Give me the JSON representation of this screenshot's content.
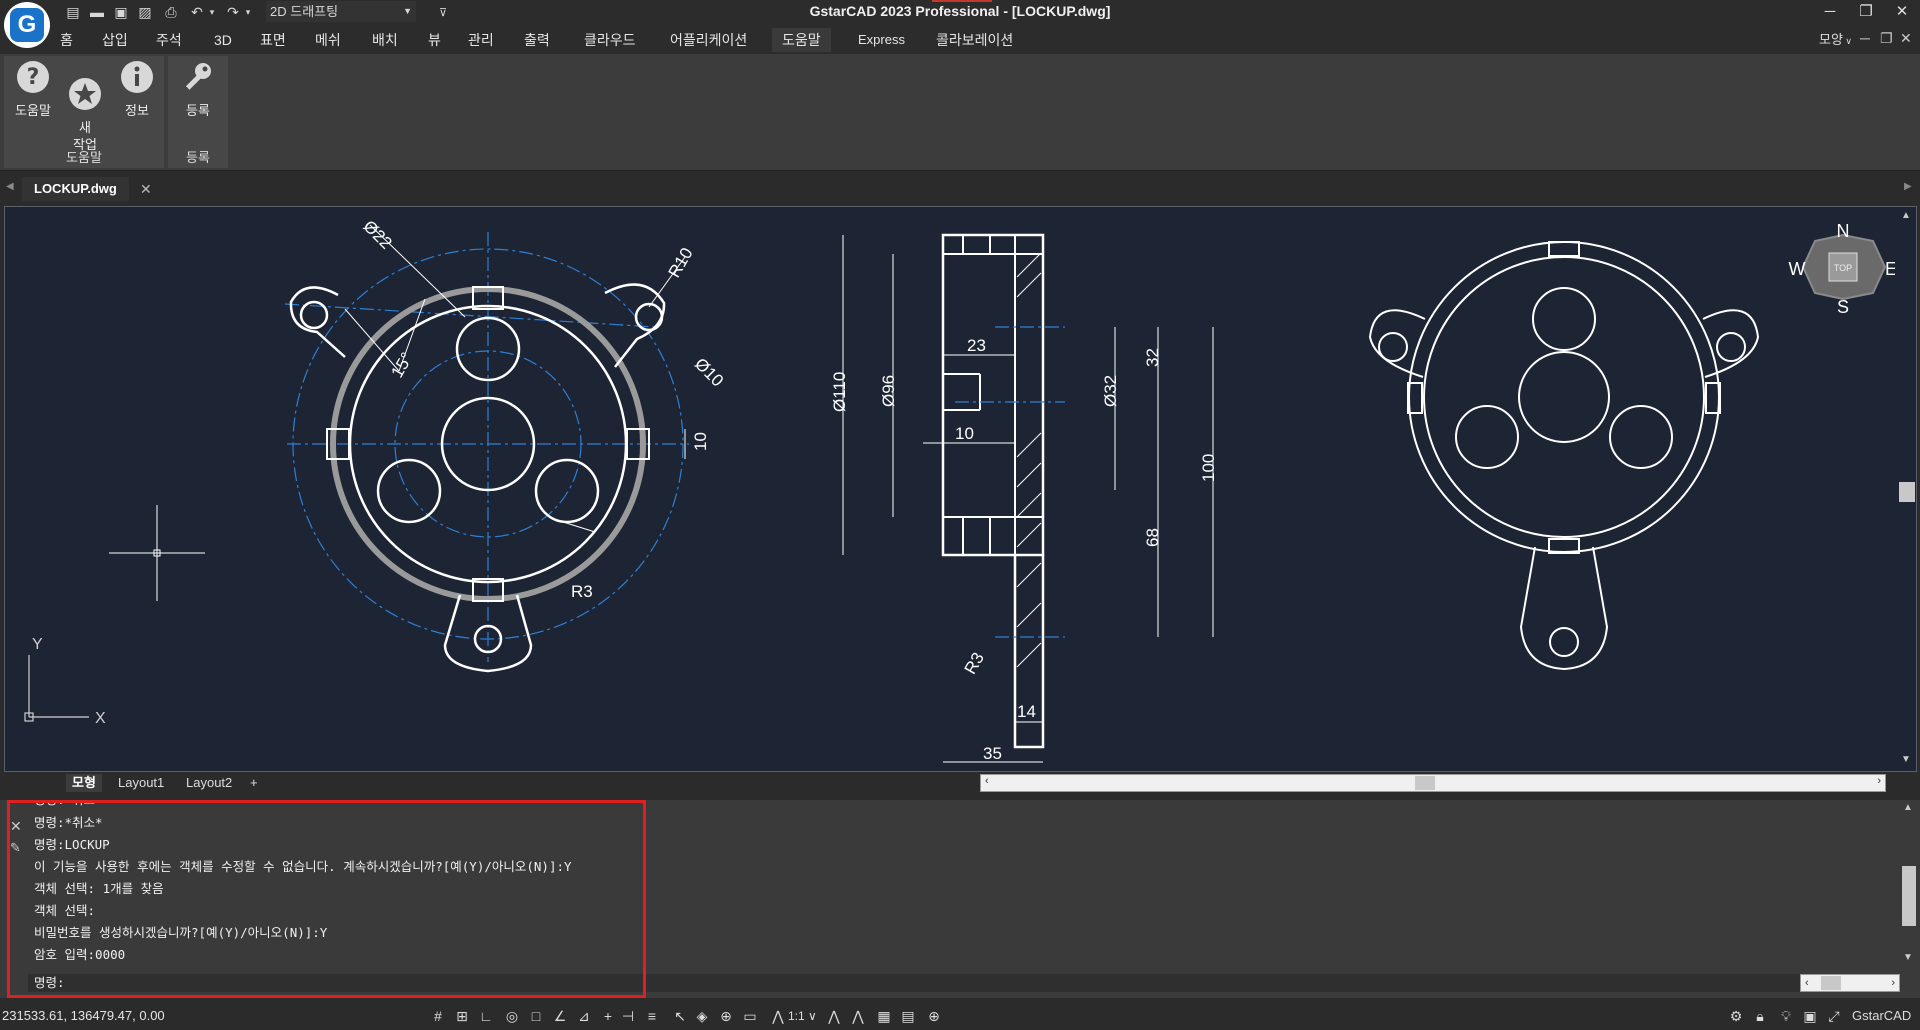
{
  "window": {
    "title": "GstarCAD 2023 Professional - [LOCKUP.dwg]",
    "workspace": "2D 드래프팅",
    "minimize": "─",
    "restore": "❐",
    "close": "✕"
  },
  "ribbon_tabs": [
    "홈",
    "삽입",
    "주석",
    "3D",
    "표면",
    "메쉬",
    "배치",
    "뷰",
    "관리",
    "출력",
    "클라우드",
    "어플리케이션",
    "도움말",
    "Express",
    "콜라보레이션"
  ],
  "ribbon_active_tab": "도움말",
  "ribbon_right": "모양",
  "ribbon_groups": {
    "help": {
      "label": "도움말",
      "buttons": [
        "도움말",
        "새\n작업",
        "정보"
      ]
    },
    "register": {
      "label": "등록",
      "buttons": [
        "등록"
      ]
    }
  },
  "file_tab": {
    "name": "LOCKUP.dwg",
    "close": "✕"
  },
  "layout_tabs": [
    "모형",
    "Layout1",
    "Layout2",
    "+"
  ],
  "layout_active": "모형",
  "drawing": {
    "front_labels": [
      "Ø22",
      "R10",
      "15°",
      "Ø10",
      "10",
      "R3"
    ],
    "section_labels": [
      "Ø110",
      "Ø96",
      "23",
      "10",
      "Ø32",
      "32",
      "100",
      "68",
      "R3",
      "14",
      "35"
    ],
    "viewcube": {
      "top": "TOP",
      "n": "N",
      "s": "S",
      "e": "E",
      "w": "W"
    },
    "ucs": {
      "x": "X",
      "y": "Y"
    }
  },
  "command": {
    "history": [
      "명령: 취소",
      "명령:*취소*",
      "명령:LOCKUP",
      "이 기능을 사용한 후에는 객체를 수정할 수 없습니다. 계속하시겠습니까?[예(Y)/아니오(N)]:Y",
      "객체 선택: 1개를 찾음",
      "객체 선택:",
      "비밀번호를 생성하시겠습니까?[예(Y)/아니오(N)]:Y",
      "암호 입력:0000"
    ],
    "prompt": "명령:"
  },
  "status": {
    "coords": "231533.61, 136479.47, 0.00",
    "scale": "1:1",
    "app_label": "GstarCAD"
  },
  "colors": {
    "canvas_bg": "#1d2433",
    "center_line": "#2f7fd6",
    "highlight": "#e02020",
    "brand": "#1a73c8"
  }
}
